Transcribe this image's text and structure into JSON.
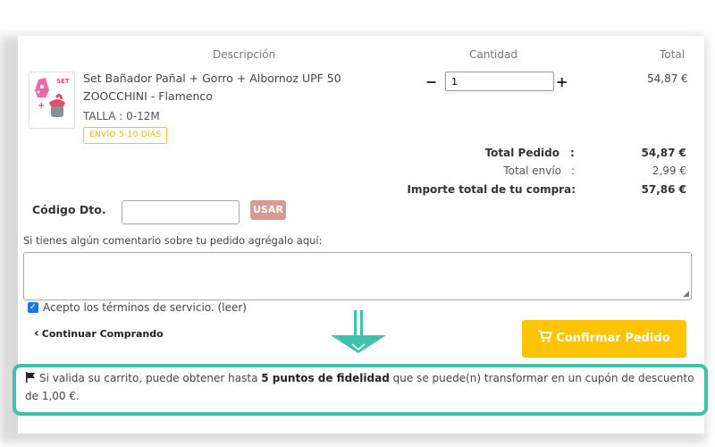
{
  "table_headers": {
    "description": "Descripción",
    "quantity": "Cantidad",
    "total": "Total"
  },
  "product": {
    "thumb_set_label": "SET",
    "name": "Set Bañador Pañal + Gorro + Albornoz UPF 50 ZOOCCHINI - Flamenco",
    "size": "TALLA : 0-12M",
    "shipping_badge": "ENVÍO 5-10 DÍAS",
    "quantity": "1",
    "minus": "−",
    "plus": "+",
    "price": "54,87 €"
  },
  "totals": {
    "order_label": "Total Pedido",
    "order_colon": ":",
    "order_value": "54,87 €",
    "shipping_label": "Total envío",
    "shipping_colon": ":",
    "shipping_value": "2,99 €",
    "grand_label": "Importe total de tu compra:",
    "grand_value": "57,86 €"
  },
  "discount": {
    "label": "Código Dto.",
    "button": "USAR"
  },
  "comment": {
    "label": "Si tienes algún comentario sobre tu pedido agrégalo aquí:"
  },
  "terms": {
    "label": "Acepto los términos de servicio. (leer)",
    "checked": true
  },
  "actions": {
    "continue": "Continuar Comprando",
    "confirm": "Confirmar Pedido"
  },
  "loyalty": {
    "prefix": "Si valida su carrito, puede obtener hasta",
    "points": "5 puntos de fidelidad",
    "suffix": "que se puede(n) transformar en un cupón de descuento de 1,00 €."
  },
  "colors": {
    "confirm_button": "#ffc400",
    "use_button": "#d99a93",
    "highlight_border": "#3fbfad",
    "arrow": "#3fbfad",
    "badge": "#f5c518"
  },
  "icons": [
    "minus-icon",
    "plus-icon",
    "chevron-left-icon",
    "cart-icon",
    "flag-icon",
    "check-icon",
    "arrow-down-icon"
  ]
}
